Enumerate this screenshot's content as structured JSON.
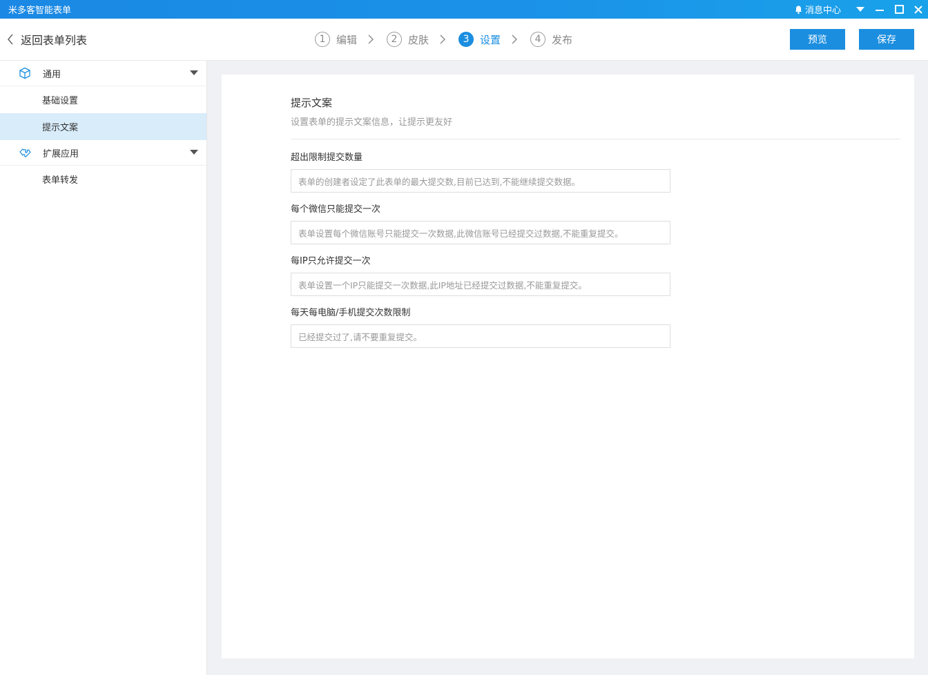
{
  "app": {
    "title": "米多客智能表单",
    "notice_label": "消息中心"
  },
  "header": {
    "back_label": "返回表单列表",
    "steps": [
      {
        "num": "1",
        "label": "编辑",
        "active": false
      },
      {
        "num": "2",
        "label": "皮肤",
        "active": false
      },
      {
        "num": "3",
        "label": "设置",
        "active": true
      },
      {
        "num": "4",
        "label": "发布",
        "active": false
      }
    ],
    "preview_label": "预览",
    "save_label": "保存"
  },
  "sidebar": {
    "groups": [
      {
        "label": "通用",
        "icon": "cube-icon",
        "items": [
          "基础设置",
          "提示文案"
        ]
      },
      {
        "label": "扩展应用",
        "icon": "puzzle-icon",
        "items": [
          "表单转发"
        ]
      }
    ],
    "active_item": "提示文案"
  },
  "content": {
    "title": "提示文案",
    "desc": "设置表单的提示文案信息，让提示更友好",
    "fields": [
      {
        "label": "超出限制提交数量",
        "value": "表单的创建者设定了此表单的最大提交数,目前已达到,不能继续提交数据。"
      },
      {
        "label": "每个微信只能提交一次",
        "value": "表单设置每个微信账号只能提交一次数据,此微信账号已经提交过数据,不能重复提交。"
      },
      {
        "label": "每IP只允许提交一次",
        "value": "表单设置一个IP只能提交一次数据,此IP地址已经提交过数据,不能重复提交。"
      },
      {
        "label": "每天每电脑/手机提交次数限制",
        "value": "已经提交过了,请不要重复提交。"
      }
    ]
  },
  "colors": {
    "accent": "#1b8ee0",
    "titlebar": "#1a88e4",
    "active_bg": "#d8ecfa"
  }
}
